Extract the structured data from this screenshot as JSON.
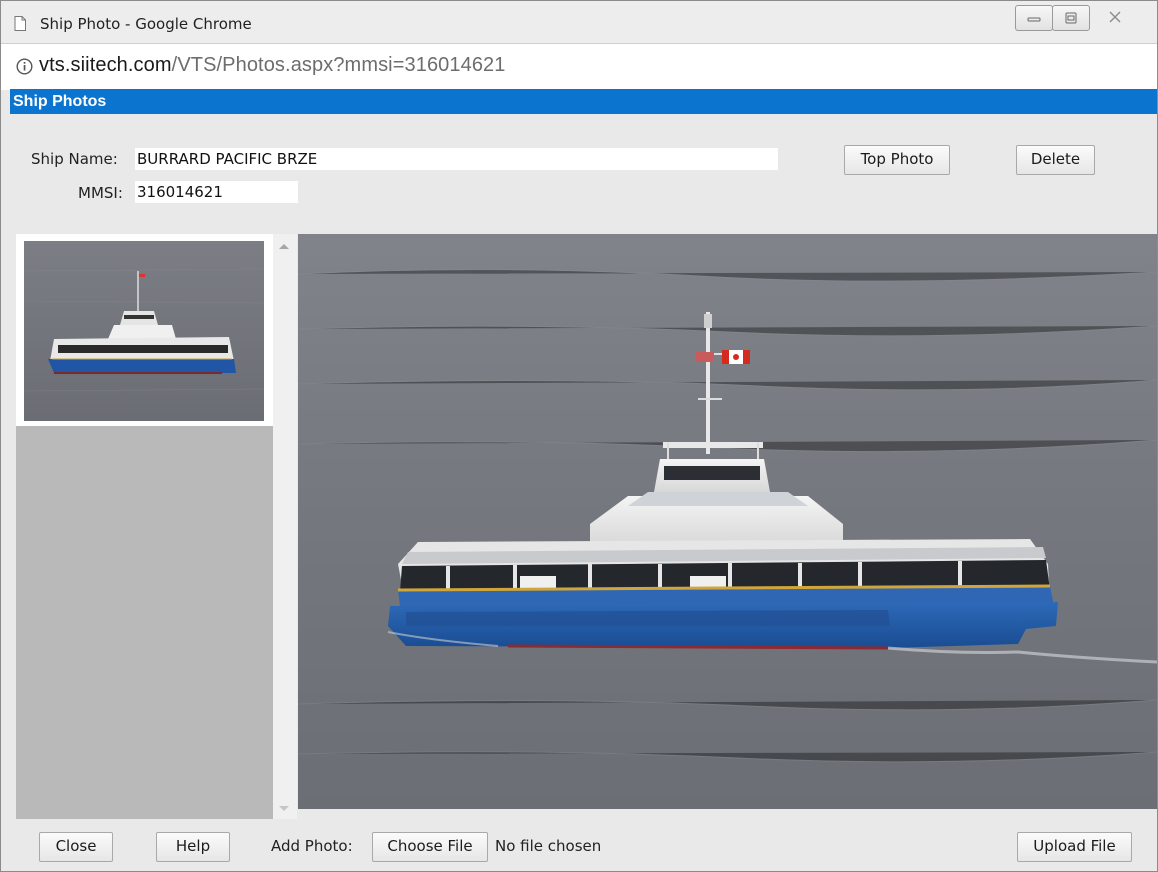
{
  "window": {
    "title": "Ship Photo - Google Chrome",
    "url_domain": "vts.siitech.com",
    "url_path": "/VTS/Photos.aspx?mmsi=316014621"
  },
  "panel": {
    "header": "Ship Photos"
  },
  "form": {
    "ship_name_label": "Ship Name:",
    "ship_name_value": "BURRARD PACIFIC BRZE",
    "mmsi_label": "MMSI:",
    "mmsi_value": "316014621",
    "top_photo_button": "Top Photo",
    "delete_button": "Delete"
  },
  "footer": {
    "close_button": "Close",
    "help_button": "Help",
    "add_photo_label": "Add Photo:",
    "choose_file_button": "Choose File",
    "file_status": "No file chosen",
    "upload_button": "Upload File"
  },
  "icons": {
    "page": "document-icon",
    "info": "info-icon",
    "minimize": "minimize-icon",
    "restore": "restore-icon",
    "close": "close-icon"
  },
  "colors": {
    "header_blue": "#0a74cf",
    "hull_blue": "#1f5aa8"
  }
}
